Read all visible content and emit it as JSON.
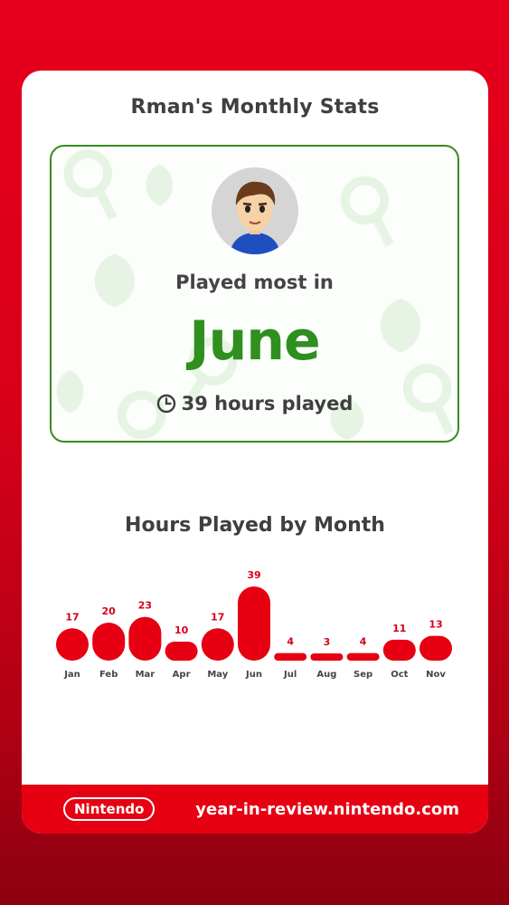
{
  "card": {
    "title": "Rman's Monthly Stats",
    "played_label": "Played most in",
    "top_month": "June",
    "hours_played": "39 hours played"
  },
  "chart_section": {
    "title": "Hours Played by Month"
  },
  "chart_data": {
    "type": "bar",
    "categories": [
      "Jan",
      "Feb",
      "Mar",
      "Apr",
      "May",
      "Jun",
      "Jul",
      "Aug",
      "Sep",
      "Oct",
      "Nov"
    ],
    "values": [
      17,
      20,
      23,
      10,
      17,
      39,
      4,
      3,
      4,
      11,
      13
    ],
    "title": "Hours Played by Month",
    "xlabel": "",
    "ylabel": "",
    "ylim": [
      0,
      39
    ],
    "grid": false,
    "bar_color": "#e60012"
  },
  "footer": {
    "logo_text": "Nintendo",
    "url": "year-in-review.nintendo.com"
  },
  "colors": {
    "brand_red": "#e60012",
    "accent_green": "#2f8f1f",
    "border_green": "#3a8a22"
  },
  "icons": {
    "clock": "clock-icon",
    "avatar": "mii-avatar"
  }
}
